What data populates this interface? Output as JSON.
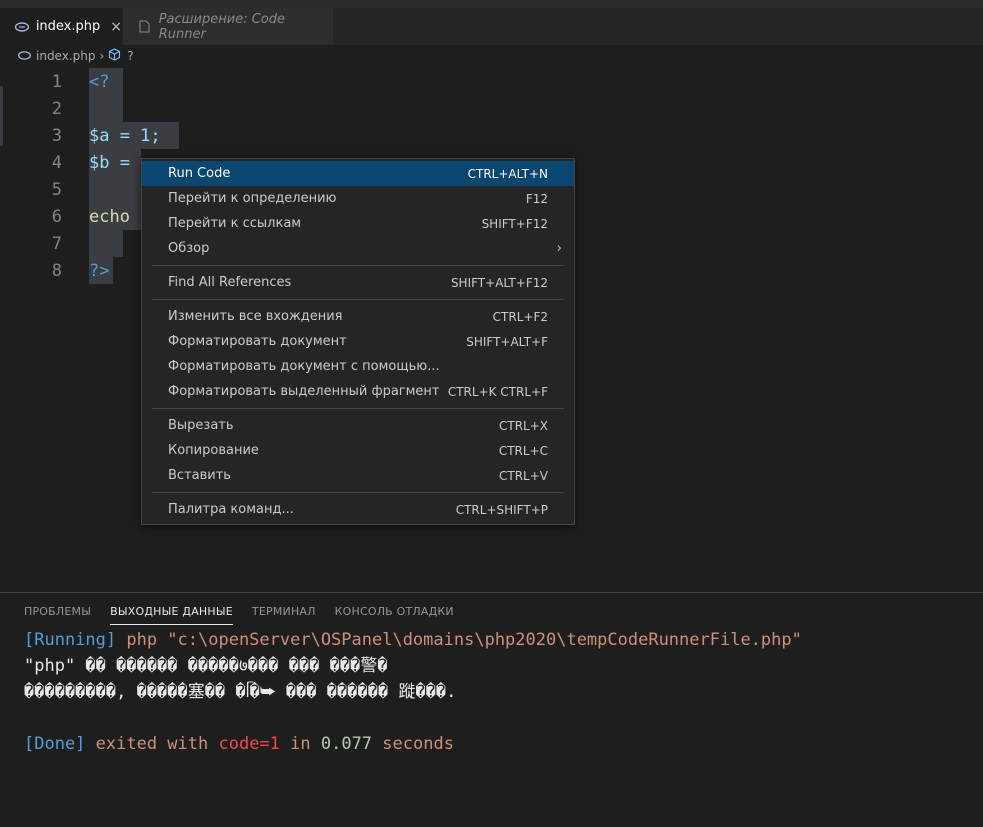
{
  "tabs": [
    {
      "label": "index.php",
      "icon": "php-elephant-icon",
      "active": true
    },
    {
      "label": "Расширение: Code Runner",
      "icon": "file-icon",
      "active": false
    }
  ],
  "breadcrumb": {
    "file": "index.php",
    "symbol": "?"
  },
  "code_lines": [
    {
      "num": "1",
      "text": "<?"
    },
    {
      "num": "2",
      "text": ""
    },
    {
      "num": "3",
      "text": "$a = 1;"
    },
    {
      "num": "4",
      "text": "$b ="
    },
    {
      "num": "5",
      "text": ""
    },
    {
      "num": "6",
      "text": "echo"
    },
    {
      "num": "7",
      "text": ""
    },
    {
      "num": "8",
      "text": "?>"
    }
  ],
  "context_menu": {
    "groups": [
      [
        {
          "label": "Run Code",
          "shortcut": "CTRL+ALT+N",
          "highlighted": true
        },
        {
          "label": "Перейти к определению",
          "shortcut": "F12"
        },
        {
          "label": "Перейти к ссылкам",
          "shortcut": "SHIFT+F12"
        },
        {
          "label": "Обзор",
          "shortcut": "",
          "submenu": true
        }
      ],
      [
        {
          "label": "Find All References",
          "shortcut": "SHIFT+ALT+F12"
        }
      ],
      [
        {
          "label": "Изменить все вхождения",
          "shortcut": "CTRL+F2"
        },
        {
          "label": "Форматировать документ",
          "shortcut": "SHIFT+ALT+F"
        },
        {
          "label": "Форматировать документ с помощью...",
          "shortcut": ""
        },
        {
          "label": "Форматировать выделенный фрагмент",
          "shortcut": "CTRL+K CTRL+F"
        }
      ],
      [
        {
          "label": "Вырезать",
          "shortcut": "CTRL+X"
        },
        {
          "label": "Копирование",
          "shortcut": "CTRL+C"
        },
        {
          "label": "Вставить",
          "shortcut": "CTRL+V"
        }
      ],
      [
        {
          "label": "Палитра команд...",
          "shortcut": "CTRL+SHIFT+P"
        }
      ]
    ]
  },
  "panel": {
    "tabs": [
      "ПРОБЛЕМЫ",
      "ВЫХОДНЫЕ ДАННЫЕ",
      "ТЕРМИНАЛ",
      "КОНСОЛЬ ОТЛАДКИ"
    ],
    "active_tab": "ВЫХОДНЫЕ ДАННЫЕ",
    "output": {
      "running_tag": "[Running]",
      "running_cmd": " php \"c:\\openServer\\OSPanel\\domains\\php2020\\tempCodeRunnerFile.php\"",
      "garbled_1_quoted": "\"php\"",
      "garbled_1_rest": " �� ������ �����७��� ��� ���警�",
      "garbled_2": "���������, �����塞�� �ᥬ�⮩ ��� ������ 蹝���.",
      "done_tag": "[Done]",
      "done_exited": " exited with ",
      "done_code": "code=1",
      "done_in": " in ",
      "done_time": "0.077",
      "done_seconds": " seconds"
    }
  },
  "colors": {
    "editor_bg": "#1e1e1e",
    "menu_bg": "#252526",
    "menu_highlight": "#094771",
    "keyword": "#569cd6",
    "variable": "#9cdcfe",
    "number": "#b5cea8",
    "function": "#dcdcaa",
    "string": "#ce9178",
    "error": "#f44747"
  }
}
